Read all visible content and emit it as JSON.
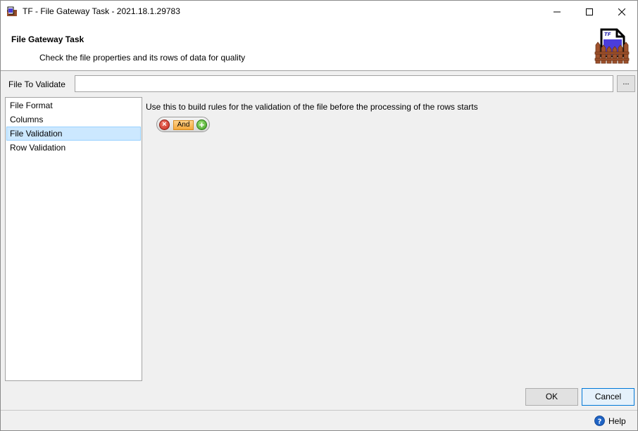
{
  "window": {
    "title": "TF - File Gateway Task - 2021.18.1.29783",
    "icons": [
      "app-icon",
      "minimize-icon",
      "maximize-icon",
      "close-icon"
    ]
  },
  "header": {
    "title": "File Gateway Task",
    "subtitle": "Check the file properties and its rows of data for quality",
    "logo_text": "TF"
  },
  "file_to_validate": {
    "label": "File To Validate",
    "value": "",
    "browse_label": "..."
  },
  "nav": {
    "items": [
      {
        "label": "File Format",
        "selected": false
      },
      {
        "label": "Columns",
        "selected": false
      },
      {
        "label": "File Validation",
        "selected": true
      },
      {
        "label": "Row Validation",
        "selected": false
      }
    ]
  },
  "main": {
    "description": "Use this to build rules for the validation of the file before the processing of the rows starts",
    "rule": {
      "operator": "And",
      "delete_glyph": "×",
      "add_glyph": "+"
    }
  },
  "buttons": {
    "ok": "OK",
    "cancel": "Cancel"
  },
  "status": {
    "help": "Help"
  },
  "colors": {
    "selection_bg": "#cce8ff",
    "selection_border": "#99d1ff",
    "default_button_border": "#0078d7",
    "and_chip": "#f5a83a",
    "delete_red": "#c8281c",
    "add_green": "#3ea120",
    "help_blue": "#1e63c4"
  }
}
